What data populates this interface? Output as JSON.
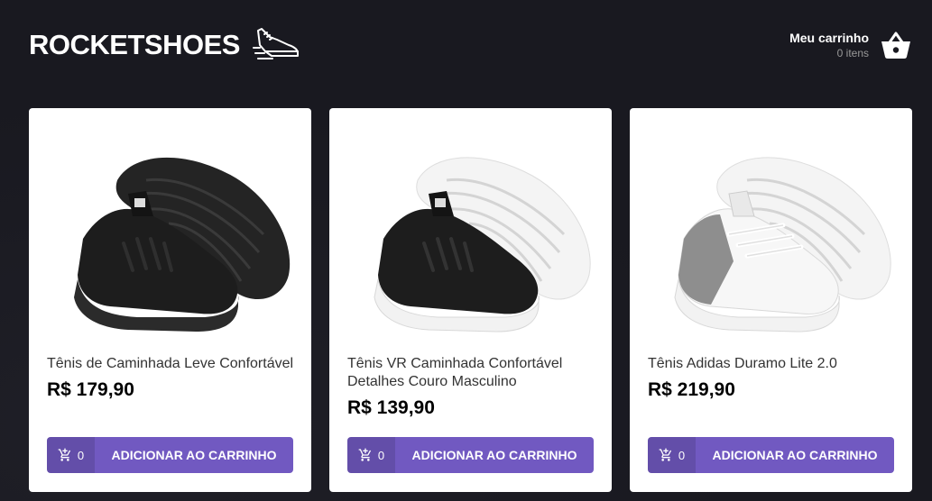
{
  "header": {
    "logo_text": "ROCKETSHOES",
    "logo_icon": "running-shoe-icon",
    "cart": {
      "title": "Meu carrinho",
      "count": "0 itens",
      "icon": "shopping-basket-icon"
    }
  },
  "colors": {
    "background": "#191920",
    "accent": "#7159c1",
    "card": "#ffffff",
    "price": "#000000"
  },
  "products": [
    {
      "title": "Tênis de Caminhada Leve Confortável",
      "price": "R$ 179,90",
      "amount": "0",
      "button_label": "ADICIONAR AO CARRINHO",
      "image_icon": "black-sneaker-image",
      "shoe_color": "#1d1d1d",
      "sole_color": "#2b2b2b"
    },
    {
      "title": "Tênis VR Caminhada Confortável Detalhes Couro Masculino",
      "price": "R$ 139,90",
      "amount": "0",
      "button_label": "ADICIONAR AO CARRINHO",
      "image_icon": "black-white-sneaker-image",
      "shoe_color": "#1d1d1d",
      "sole_color": "#f2f2f2"
    },
    {
      "title": "Tênis Adidas Duramo Lite 2.0",
      "price": "R$ 219,90",
      "amount": "0",
      "button_label": "ADICIONAR AO CARRINHO",
      "image_icon": "white-gray-sneaker-image",
      "shoe_color": "#f4f4f4",
      "sole_color": "#f2f2f2"
    }
  ]
}
